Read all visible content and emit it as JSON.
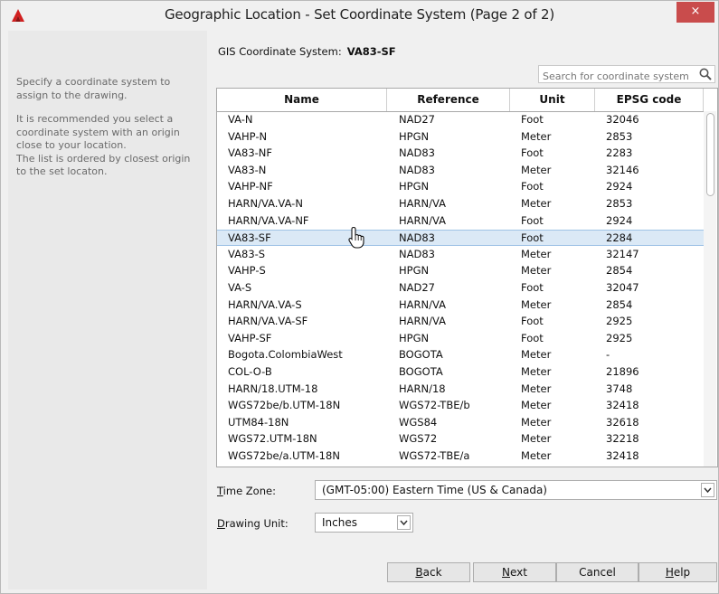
{
  "window": {
    "title": "Geographic Location - Set Coordinate System (Page 2 of 2)",
    "close_glyph": "×",
    "app_icon": "autocad-logo-icon"
  },
  "left_panel": {
    "intro": "Specify a coordinate system to assign to the drawing.",
    "note": "It is recommended you select a coordinate system with an origin close to your location.\nThe list is ordered by closest origin to the set locaton."
  },
  "gis": {
    "label": "GIS Coordinate System:",
    "value": "VA83-SF"
  },
  "search": {
    "placeholder": "Search for coordinate system",
    "icon": "search-icon"
  },
  "table": {
    "columns": [
      "Name",
      "Reference",
      "Unit",
      "EPSG code"
    ],
    "selected_index": 7,
    "rows": [
      [
        "VA-N",
        "NAD27",
        "Foot",
        "32046"
      ],
      [
        "VAHP-N",
        "HPGN",
        "Meter",
        "2853"
      ],
      [
        "VA83-NF",
        "NAD83",
        "Foot",
        "2283"
      ],
      [
        "VA83-N",
        "NAD83",
        "Meter",
        "32146"
      ],
      [
        "VAHP-NF",
        "HPGN",
        "Foot",
        "2924"
      ],
      [
        "HARN/VA.VA-N",
        "HARN/VA",
        "Meter",
        "2853"
      ],
      [
        "HARN/VA.VA-NF",
        "HARN/VA",
        "Foot",
        "2924"
      ],
      [
        "VA83-SF",
        "NAD83",
        "Foot",
        "2284"
      ],
      [
        "VA83-S",
        "NAD83",
        "Meter",
        "32147"
      ],
      [
        "VAHP-S",
        "HPGN",
        "Meter",
        "2854"
      ],
      [
        "VA-S",
        "NAD27",
        "Foot",
        "32047"
      ],
      [
        "HARN/VA.VA-S",
        "HARN/VA",
        "Meter",
        "2854"
      ],
      [
        "HARN/VA.VA-SF",
        "HARN/VA",
        "Foot",
        "2925"
      ],
      [
        "VAHP-SF",
        "HPGN",
        "Foot",
        "2925"
      ],
      [
        "Bogota.ColombiaWest",
        "BOGOTA",
        "Meter",
        "-"
      ],
      [
        "COL-O-B",
        "BOGOTA",
        "Meter",
        "21896"
      ],
      [
        "HARN/18.UTM-18",
        "HARN/18",
        "Meter",
        "3748"
      ],
      [
        "WGS72be/b.UTM-18N",
        "WGS72-TBE/b",
        "Meter",
        "32418"
      ],
      [
        "UTM84-18N",
        "WGS84",
        "Meter",
        "32618"
      ],
      [
        "WGS72.UTM-18N",
        "WGS72",
        "Meter",
        "32218"
      ],
      [
        "WGS72be/a.UTM-18N",
        "WGS72-TBE/a",
        "Meter",
        "32418"
      ]
    ]
  },
  "time_zone": {
    "label_prefix": "",
    "label_underlined": "T",
    "label_rest": "ime Zone:",
    "value": "(GMT-05:00) Eastern Time (US & Canada)"
  },
  "drawing_unit": {
    "label_underlined": "D",
    "label_rest": "rawing Unit:",
    "value": "Inches"
  },
  "buttons": {
    "back_u": "B",
    "back_rest": "ack",
    "next_u": "N",
    "next_rest": "ext",
    "cancel": "Cancel",
    "help_u": "H",
    "help_rest": "elp"
  },
  "colors": {
    "selection_bg": "#dbe9f6",
    "close_bg": "#c94c4c",
    "logo_red": "#d11f1f"
  }
}
